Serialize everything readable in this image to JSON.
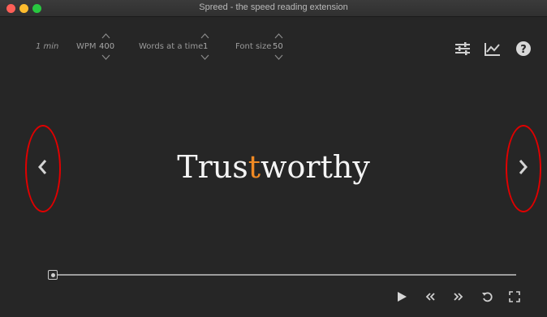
{
  "window": {
    "title": "Spreed - the speed reading extension"
  },
  "topbar": {
    "time_estimate": "1 min",
    "wpm": {
      "label": "WPM",
      "value": "400"
    },
    "words_at_a_time": {
      "label": "Words at a time",
      "value": "1"
    },
    "font_size": {
      "label": "Font size",
      "value": "50"
    }
  },
  "toolbar_icons": [
    "settings-sliders-icon",
    "stats-chart-icon",
    "help-icon"
  ],
  "reader": {
    "word_before": "Trus",
    "word_focus": "t",
    "word_after": "worthy",
    "focus_color": "#f08a24"
  },
  "progress": {
    "fraction": 0.0
  },
  "controls": [
    "play-icon",
    "rewind-icon",
    "fast-forward-icon",
    "restart-icon",
    "fullscreen-icon"
  ],
  "annotation_color": "#e00000"
}
